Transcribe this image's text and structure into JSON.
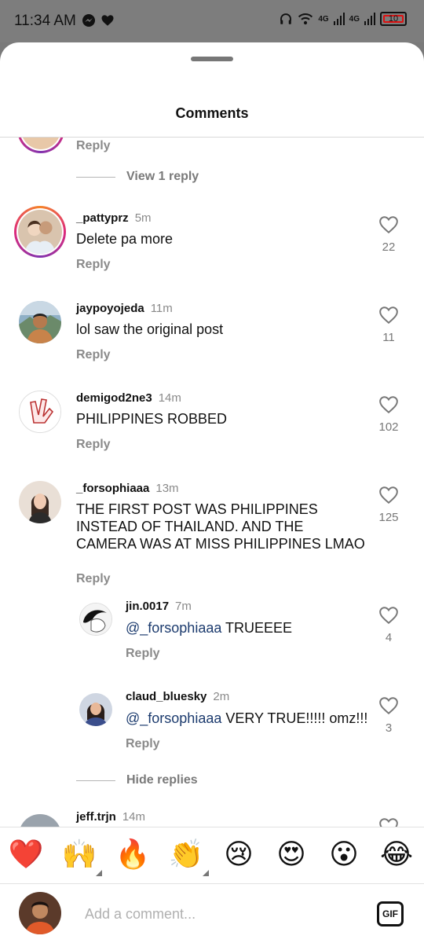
{
  "status_bar": {
    "time": "11:34 AM",
    "network_1": "4G",
    "network_2": "4G",
    "battery": "10"
  },
  "sheet": {
    "title": "Comments"
  },
  "previous": {
    "reply_label": "Reply",
    "view_replies": "View 1 reply"
  },
  "comments": [
    {
      "username": "_pattyprz",
      "time": "5m",
      "text": "Delete pa more",
      "reply": "Reply",
      "likes": "22"
    },
    {
      "username": "jaypoyojeda",
      "time": "11m",
      "text": "lol saw the original post",
      "reply": "Reply",
      "likes": "11"
    },
    {
      "username": "demigod2ne3",
      "time": "14m",
      "text": "PHILIPPINES ROBBED",
      "reply": "Reply",
      "likes": "102"
    },
    {
      "username": "_forsophiaaa",
      "time": "13m",
      "text": "THE FIRST POST WAS PHILIPPINES INSTEAD OF THAILAND. AND THE CAMERA WAS AT MISS PHILIPPINES LMAO",
      "reply": "Reply",
      "likes": "125"
    }
  ],
  "replies": [
    {
      "username": "jin.0017",
      "time": "7m",
      "mention": "@_forsophiaaa",
      "text": " TRUEEEE",
      "reply": "Reply",
      "likes": "4"
    },
    {
      "username": "claud_bluesky",
      "time": "2m",
      "mention": "@_forsophiaaa",
      "text": " VERY TRUE!!!!! omz!!!",
      "reply": "Reply",
      "likes": "3"
    }
  ],
  "hide_replies": "Hide replies",
  "partial_comment": {
    "username": "jeff.trjn",
    "time": "14m"
  },
  "emoji_bar": [
    {
      "glyph": "❤️",
      "name": "red-heart-emoji"
    },
    {
      "glyph": "🙌",
      "name": "raising-hands-emoji"
    },
    {
      "glyph": "🔥",
      "name": "fire-emoji"
    },
    {
      "glyph": "👏",
      "name": "clapping-hands-emoji"
    },
    {
      "glyph": "😢",
      "name": "crying-face-emoji"
    },
    {
      "glyph": "😍",
      "name": "heart-eyes-emoji"
    },
    {
      "glyph": "😮",
      "name": "open-mouth-emoji"
    },
    {
      "glyph": "😂",
      "name": "tears-of-joy-emoji"
    }
  ],
  "composer": {
    "placeholder": "Add a comment...",
    "gif_label": "GIF"
  },
  "colors": {
    "mention": "#1c3b6e",
    "story_ring": "#dd2a7b",
    "battery_low": "#dd1111"
  }
}
